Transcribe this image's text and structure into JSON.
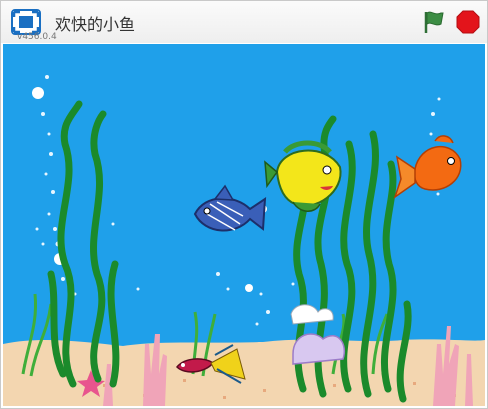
{
  "player": {
    "title": "欢快的小鱼",
    "version": "v456.0.4"
  },
  "icons": {
    "fullscreen": "fullscreen-icon",
    "flag": "green-flag-icon",
    "stop": "stop-sign-icon"
  },
  "colors": {
    "water": "#1fa0ea",
    "sand": "#f3d6b0",
    "seaweed": "#1b8a2b",
    "flag": "#2f7f3a",
    "stop": "#e3141b",
    "fullscreen": "#1a6fc2"
  },
  "stage": {
    "sprites": [
      "blue-fish",
      "yellow-fish",
      "orange-goldfish",
      "betta-fish"
    ]
  }
}
